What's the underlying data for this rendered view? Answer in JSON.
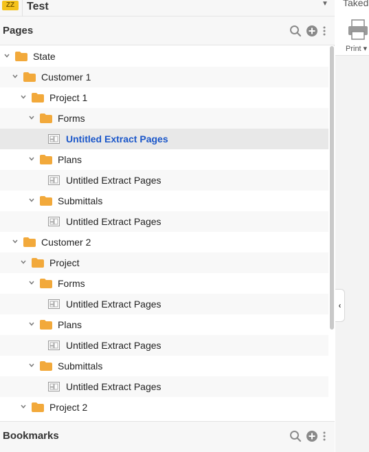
{
  "topbar": {
    "logo_text": "ZZ",
    "document_title": "Test"
  },
  "pages_panel": {
    "title": "Pages",
    "tree": [
      {
        "label": "State",
        "type": "folder"
      },
      {
        "label": "Customer 1",
        "type": "folder"
      },
      {
        "label": "Project 1",
        "type": "folder"
      },
      {
        "label": "Forms",
        "type": "folder"
      },
      {
        "label": "Untitled Extract Pages",
        "type": "page",
        "selected": true
      },
      {
        "label": "Plans",
        "type": "folder"
      },
      {
        "label": "Untitled Extract Pages",
        "type": "page"
      },
      {
        "label": "Submittals",
        "type": "folder"
      },
      {
        "label": "Untitled Extract Pages",
        "type": "page"
      },
      {
        "label": "Customer 2",
        "type": "folder"
      },
      {
        "label": "Project",
        "type": "folder"
      },
      {
        "label": "Forms",
        "type": "folder"
      },
      {
        "label": "Untitled Extract Pages",
        "type": "page"
      },
      {
        "label": "Plans",
        "type": "folder"
      },
      {
        "label": "Untitled Extract Pages",
        "type": "page"
      },
      {
        "label": "Submittals",
        "type": "folder"
      },
      {
        "label": "Untitled Extract Pages",
        "type": "page"
      },
      {
        "label": "Project 2",
        "type": "folder"
      }
    ]
  },
  "bookmarks_panel": {
    "title": "Bookmarks"
  },
  "right_toolbar": {
    "partial_label": "Taked",
    "print_label": "Print ▾"
  },
  "colors": {
    "folder": "#f2a93b",
    "selected_text": "#1a56c9",
    "selected_row": "#e8e8e8"
  }
}
